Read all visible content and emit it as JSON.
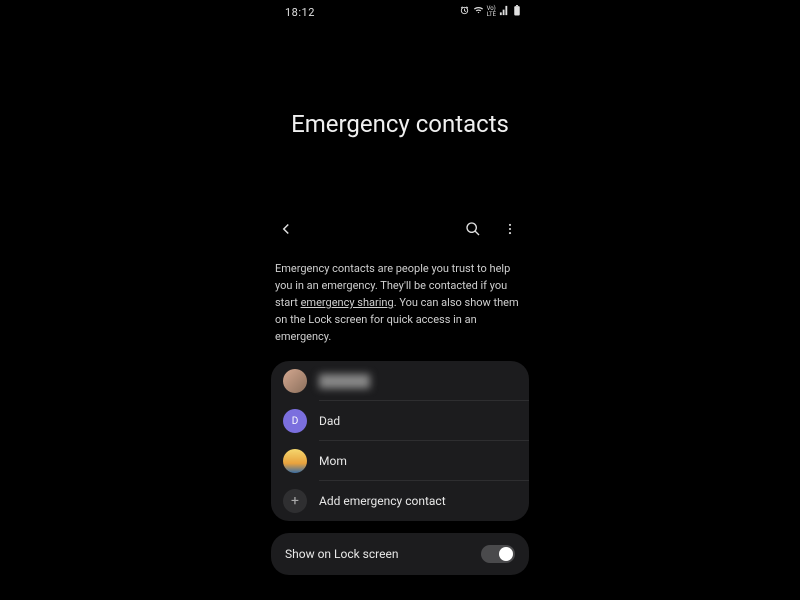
{
  "status": {
    "time": "18:12"
  },
  "page": {
    "title": "Emergency contacts"
  },
  "description": {
    "part1": "Emergency contacts are people you trust to help you in an emergency. They'll be contacted if you start ",
    "link": "emergency sharing",
    "part2": ". You can also show them on the Lock screen for quick access in an emergency."
  },
  "contacts": {
    "items": [
      {
        "name": "██████",
        "avatar_type": "photo1",
        "blurred": true
      },
      {
        "name": "Dad",
        "avatar_type": "letter",
        "letter": "D",
        "blurred": false
      },
      {
        "name": "Mom",
        "avatar_type": "photo2",
        "blurred": false
      }
    ],
    "add_label": "Add emergency contact"
  },
  "lock_screen": {
    "label": "Show on Lock screen",
    "toggle_on": true
  }
}
